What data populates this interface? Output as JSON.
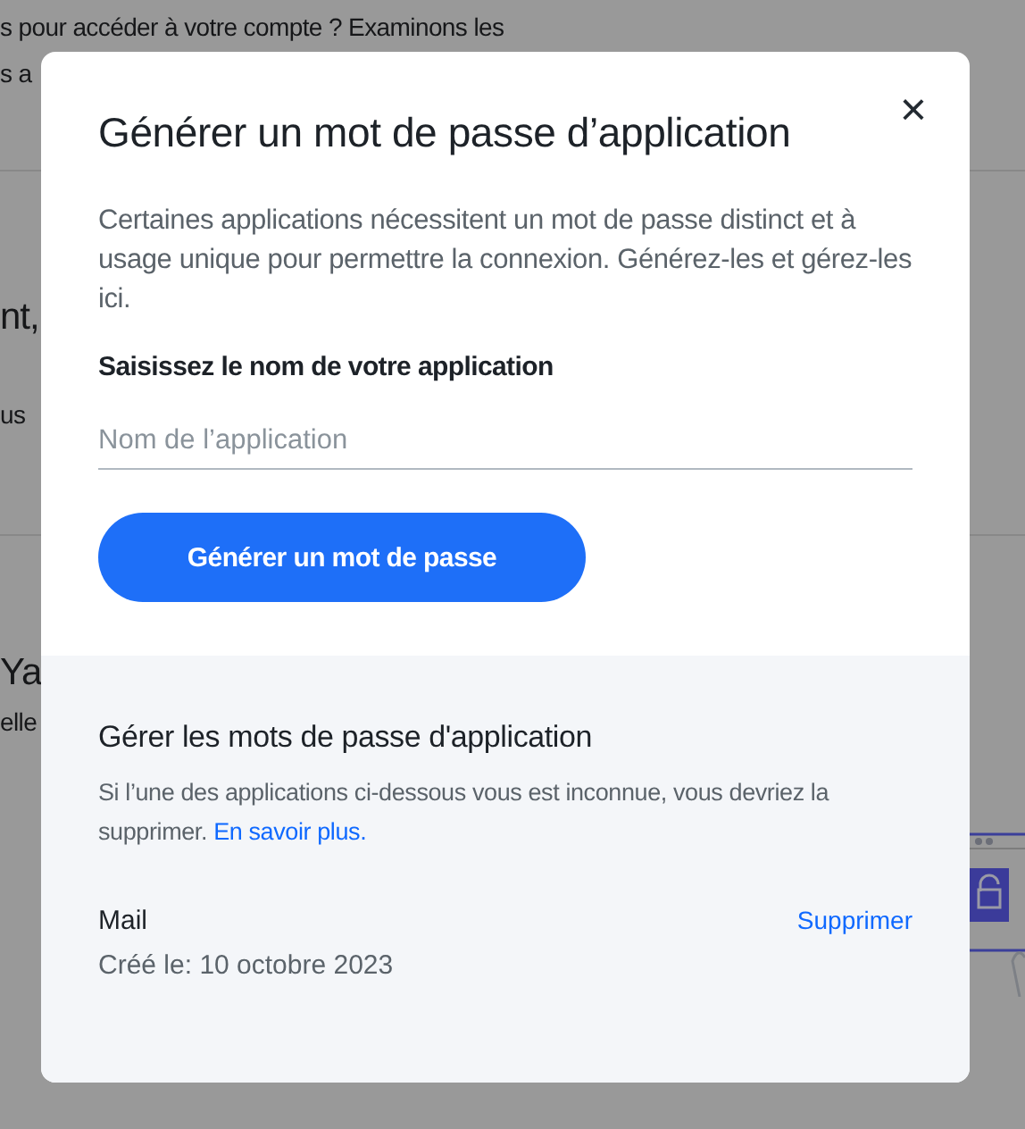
{
  "background": {
    "lines": [
      {
        "text": "s pour accéder à votre compte ? Examinons les",
        "kind": "body"
      },
      {
        "text": "s a",
        "kind": "body"
      },
      {
        "text": "nt,",
        "kind": "heading"
      },
      {
        "text": "us",
        "kind": "body"
      },
      {
        "text": "Ya",
        "kind": "heading"
      },
      {
        "text": "elle",
        "kind": "body"
      }
    ]
  },
  "dialog": {
    "title": "Générer un mot de passe d’application",
    "close": "×",
    "description": "Certaines applications nécessitent un mot de passe distinct et à usage unique pour permettre la connexion. Générez-les et gérez-les ici.",
    "field_label": "Saisissez le nom de votre application",
    "field": {
      "placeholder": "Nom de l’application"
    },
    "button": "Générer un mot de passe",
    "manage": {
      "title": "Gérer les mots de passe d'application",
      "note": "Si l’une des applications ci-dessous vous est inconnue, vous devriez la supprimer.",
      "link": "En savoir plus.",
      "apps": [
        {
          "name": "Mail",
          "created": "Créé le: 10 octobre 2023",
          "action": "Supprimer"
        }
      ]
    }
  }
}
